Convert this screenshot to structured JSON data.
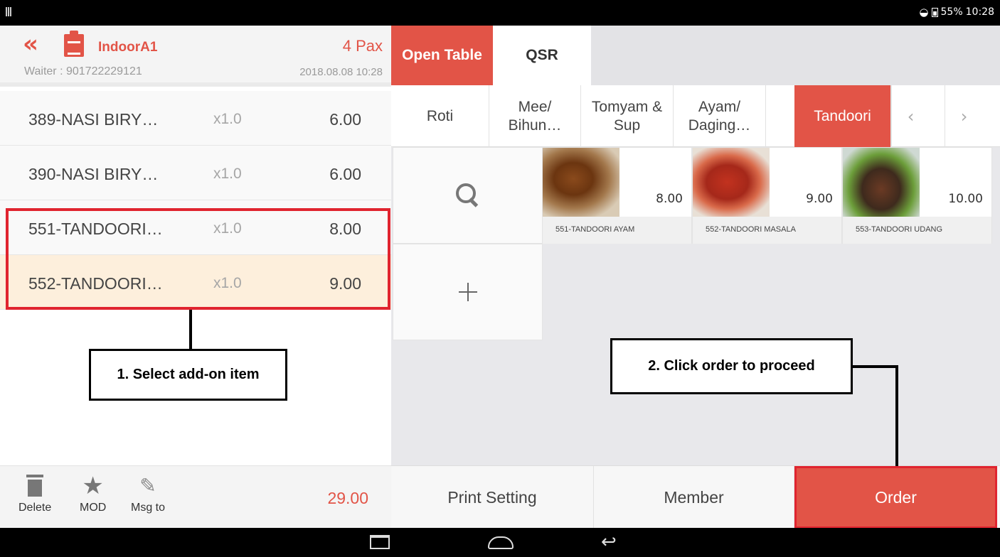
{
  "status_bar": {
    "battery": "55%",
    "time": "10:28"
  },
  "header": {
    "table_name": "IndoorA1",
    "pax": "4 Pax",
    "waiter": "Waiter : 901722229121",
    "datetime": "2018.08.08 10:28"
  },
  "order_items": [
    {
      "name": "389-NASI BIRY…",
      "qty": "x1.0",
      "price": "6.00"
    },
    {
      "name": "390-NASI BIRY…",
      "qty": "x1.0",
      "price": "6.00"
    },
    {
      "name": "551-TANDOORI…",
      "qty": "x1.0",
      "price": "8.00"
    },
    {
      "name": "552-TANDOORI…",
      "qty": "x1.0",
      "price": "9.00"
    }
  ],
  "footer_tools": {
    "delete": "Delete",
    "mod": "MOD",
    "msg": "Msg to"
  },
  "total": "29.00",
  "mode_tabs": {
    "open_table": "Open Table",
    "qsr": "QSR"
  },
  "categories": {
    "roti": "Roti",
    "mee_line1": "Mee/",
    "mee_line2": "Bihun…",
    "tomyam_line1": "Tomyam &",
    "tomyam_line2": "Sup",
    "ayam_line1": "Ayam/",
    "ayam_line2": "Daging…",
    "tandoori": "Tandoori",
    "prev_arrow": "‹",
    "next_arrow": "›"
  },
  "products": [
    {
      "name": "551-TANDOORI AYAM",
      "price": "8.00"
    },
    {
      "name": "552-TANDOORI MASALA",
      "price": "9.00"
    },
    {
      "name": "553-TANDOORI UDANG",
      "price": "10.00"
    }
  ],
  "bottom_buttons": {
    "print_setting": "Print Setting",
    "member": "Member",
    "order": "Order"
  },
  "annotations": {
    "step1": "1. Select add-on item",
    "step2": "2. Click order to proceed"
  },
  "colors": {
    "accent": "#e25447",
    "highlight_border": "#e0242f",
    "selected_row": "#fdefdc"
  }
}
